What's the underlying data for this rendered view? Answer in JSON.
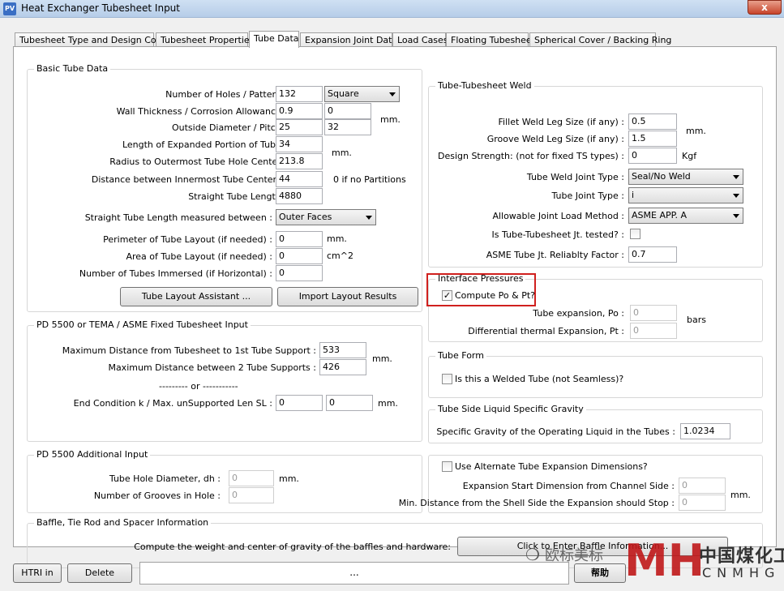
{
  "window": {
    "app_icon": "PV",
    "title": "Heat Exchanger Tubesheet Input",
    "close_label": "x"
  },
  "tabs": [
    {
      "label": "Tubesheet Type and Design Code"
    },
    {
      "label": "Tubesheet Properties"
    },
    {
      "label": "Tube Data"
    },
    {
      "label": "Expansion Joint Data"
    },
    {
      "label": "Load Cases"
    },
    {
      "label": "Floating Tubesheet"
    },
    {
      "label": "Spherical Cover / Backing Ring"
    }
  ],
  "basic": {
    "title": "Basic Tube Data",
    "holes_label": "Number of Holes / Pattern :",
    "holes": "132",
    "pattern": "Square",
    "wall_label": "Wall Thickness / Corrosion Allowance :",
    "wall": "0.9",
    "corrosion": "0",
    "od_label": "Outside Diameter / Pitch :",
    "od": "25",
    "pitch": "32",
    "mm1": "mm.",
    "length_exp_label": "Length of Expanded Portion of Tube :",
    "length_exp": "34",
    "radius_label": "Radius to Outermost Tube Hole Center :",
    "radius": "213.8",
    "mm2": "mm.",
    "distance_label": "Distance between Innermost Tube Centers :",
    "distance": "44",
    "partitions_note": "0 if no Partitions",
    "straight_label": "Straight Tube Length :",
    "straight": "4880",
    "measured_label": "Straight Tube Length measured between :",
    "measured": "Outer Faces",
    "perimeter_label": "Perimeter of Tube Layout (if needed) :",
    "perimeter": "0",
    "perimeter_unit": "mm.",
    "area_label": "Area of Tube Layout (if needed) :",
    "area": "0",
    "area_unit": "cm^2",
    "immersed_label": "Number of Tubes Immersed (if Horizontal) :",
    "immersed": "0",
    "layout_btn": "Tube Layout Assistant ...",
    "import_btn": "Import Layout Results"
  },
  "weld": {
    "title": "Tube-Tubesheet Weld",
    "fillet_label": "Fillet Weld Leg Size (if any) :",
    "fillet": "0.5",
    "groove_label": "Groove Weld Leg Size (if any) :",
    "groove": "1.5",
    "mm": "mm.",
    "strength_label": "Design Strength: (not for fixed TS types) :",
    "strength": "0",
    "strength_unit": "Kgf",
    "weld_type_label": "Tube Weld Joint Type :",
    "weld_type": "Seal/No Weld",
    "joint_type_label": "Tube Joint Type :",
    "joint_type": "i",
    "load_method_label": "Allowable Joint Load Method :",
    "load_method": "ASME APP. A",
    "tested_label": "Is Tube-Tubesheet Jt. tested? :",
    "reliability_label": "ASME Tube Jt. Reliablty Factor :",
    "reliability": "0.7"
  },
  "interface": {
    "title": "Interface Pressures",
    "compute_label": "Compute Po & Pt?",
    "compute_checked": true,
    "po_label": "Tube expansion, Po :",
    "po": "0",
    "pt_label": "Differential thermal Expansion, Pt :",
    "pt": "0",
    "unit": "bars"
  },
  "tubeform": {
    "title": "Tube Form",
    "welded_label": "Is this a Welded Tube (not Seamless)?"
  },
  "gravity": {
    "title": "Tube Side Liquid Specific Gravity",
    "label": "Specific Gravity of the Operating Liquid in the Tubes :",
    "value": "1.0234"
  },
  "pd5500": {
    "title": "PD 5500 or TEMA / ASME Fixed Tubesheet Input",
    "max1_label": "Maximum Distance from Tubesheet to 1st Tube Support :",
    "max1": "533",
    "max2_label": "Maximum Distance between 2 Tube Supports :",
    "max2": "426",
    "mm1": "mm.",
    "or": "--------- or -----------",
    "endcond_label": "End Condition k / Max. unSupported Len SL :",
    "endcond": "0",
    "sl": "0",
    "mm2": "mm."
  },
  "pd5500add": {
    "title": "PD 5500 Additional Input",
    "hole_label": "Tube Hole Diameter, dh :",
    "hole": "0",
    "mm": "mm.",
    "grooves_label": "Number of Grooves in Hole :",
    "grooves": "0"
  },
  "altexp": {
    "title": "Use Alternate Tube Expansion Dimensions?",
    "start_label": "Expansion Start Dimension from Channel Side :",
    "start": "0",
    "stop_label": "Min. Distance from the Shell Side the Expansion should Stop :",
    "stop": "0",
    "mm": "mm."
  },
  "baffle": {
    "title": "Baffle, Tie Rod and Spacer  Information",
    "label": "Compute the weight and center of gravity of the baffles and hardware:",
    "btn": "Click to Enter Baffle Information..."
  },
  "bottom": {
    "htri": "HTRI in",
    "delete": "Delete",
    "status": "...",
    "help": "帮助"
  },
  "watermark": {
    "wechat": "欧标美标",
    "brand_cn": "中国煤化工",
    "brand_en": "CNMHG",
    "mh": "MH"
  },
  "colors": {
    "accent_red": "#d0201e",
    "watermark_red": "#c0181a"
  }
}
